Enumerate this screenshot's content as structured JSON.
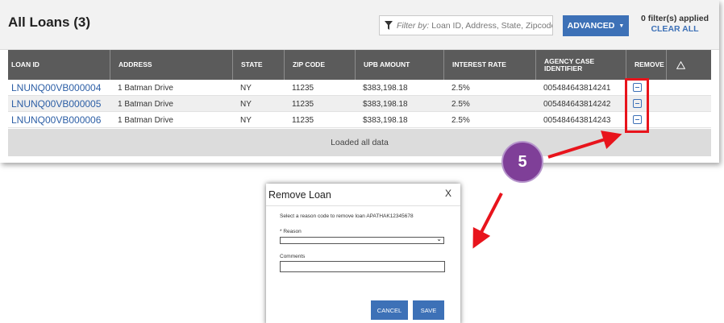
{
  "header": {
    "title": "All Loans (3)",
    "filter_label": "Filter by:",
    "filter_placeholder": "Loan ID, Address, State, Zipcode",
    "advanced_label": "ADVANCED",
    "filters_applied": "0 filter(s) applied",
    "clear_all": "CLEAR ALL"
  },
  "table": {
    "columns": [
      "LOAN ID",
      "ADDRESS",
      "STATE",
      "ZIP CODE",
      "UPB AMOUNT",
      "INTEREST RATE",
      "AGENCY CASE IDENTIFIER",
      "REMOVE"
    ],
    "rows": [
      {
        "loan_id": "LNUNQ00VB000004",
        "address": "1 Batman Drive",
        "state": "NY",
        "zip": "11235",
        "upb": "$383,198.18",
        "rate": "2.5%",
        "agency": "005484643814241"
      },
      {
        "loan_id": "LNUNQ00VB000005",
        "address": "1 Batman Drive",
        "state": "NY",
        "zip": "11235",
        "upb": "$383,198.18",
        "rate": "2.5%",
        "agency": "005484643814242"
      },
      {
        "loan_id": "LNUNQ00VB000006",
        "address": "1 Batman Drive",
        "state": "NY",
        "zip": "11235",
        "upb": "$383,198.18",
        "rate": "2.5%",
        "agency": "005484643814243"
      }
    ],
    "footer": "Loaded all data"
  },
  "step_badge": "5",
  "modal": {
    "title": "Remove Loan",
    "close": "X",
    "description": "Select a reason code to remove loan APATHAK12345678",
    "reason_label": "* Reason",
    "reason_value": "",
    "comments_label": "Comments",
    "comments_value": "",
    "cancel": "CANCEL",
    "save": "SAVE"
  },
  "colors": {
    "accent": "#3d71b7",
    "header_bg": "#5b5b5b",
    "highlight": "#e8141c",
    "badge": "#7f3f98"
  },
  "icons": [
    "filter-icon",
    "caret-down-icon",
    "warning-icon",
    "remove-icon",
    "close-icon",
    "chevron-down-icon"
  ]
}
